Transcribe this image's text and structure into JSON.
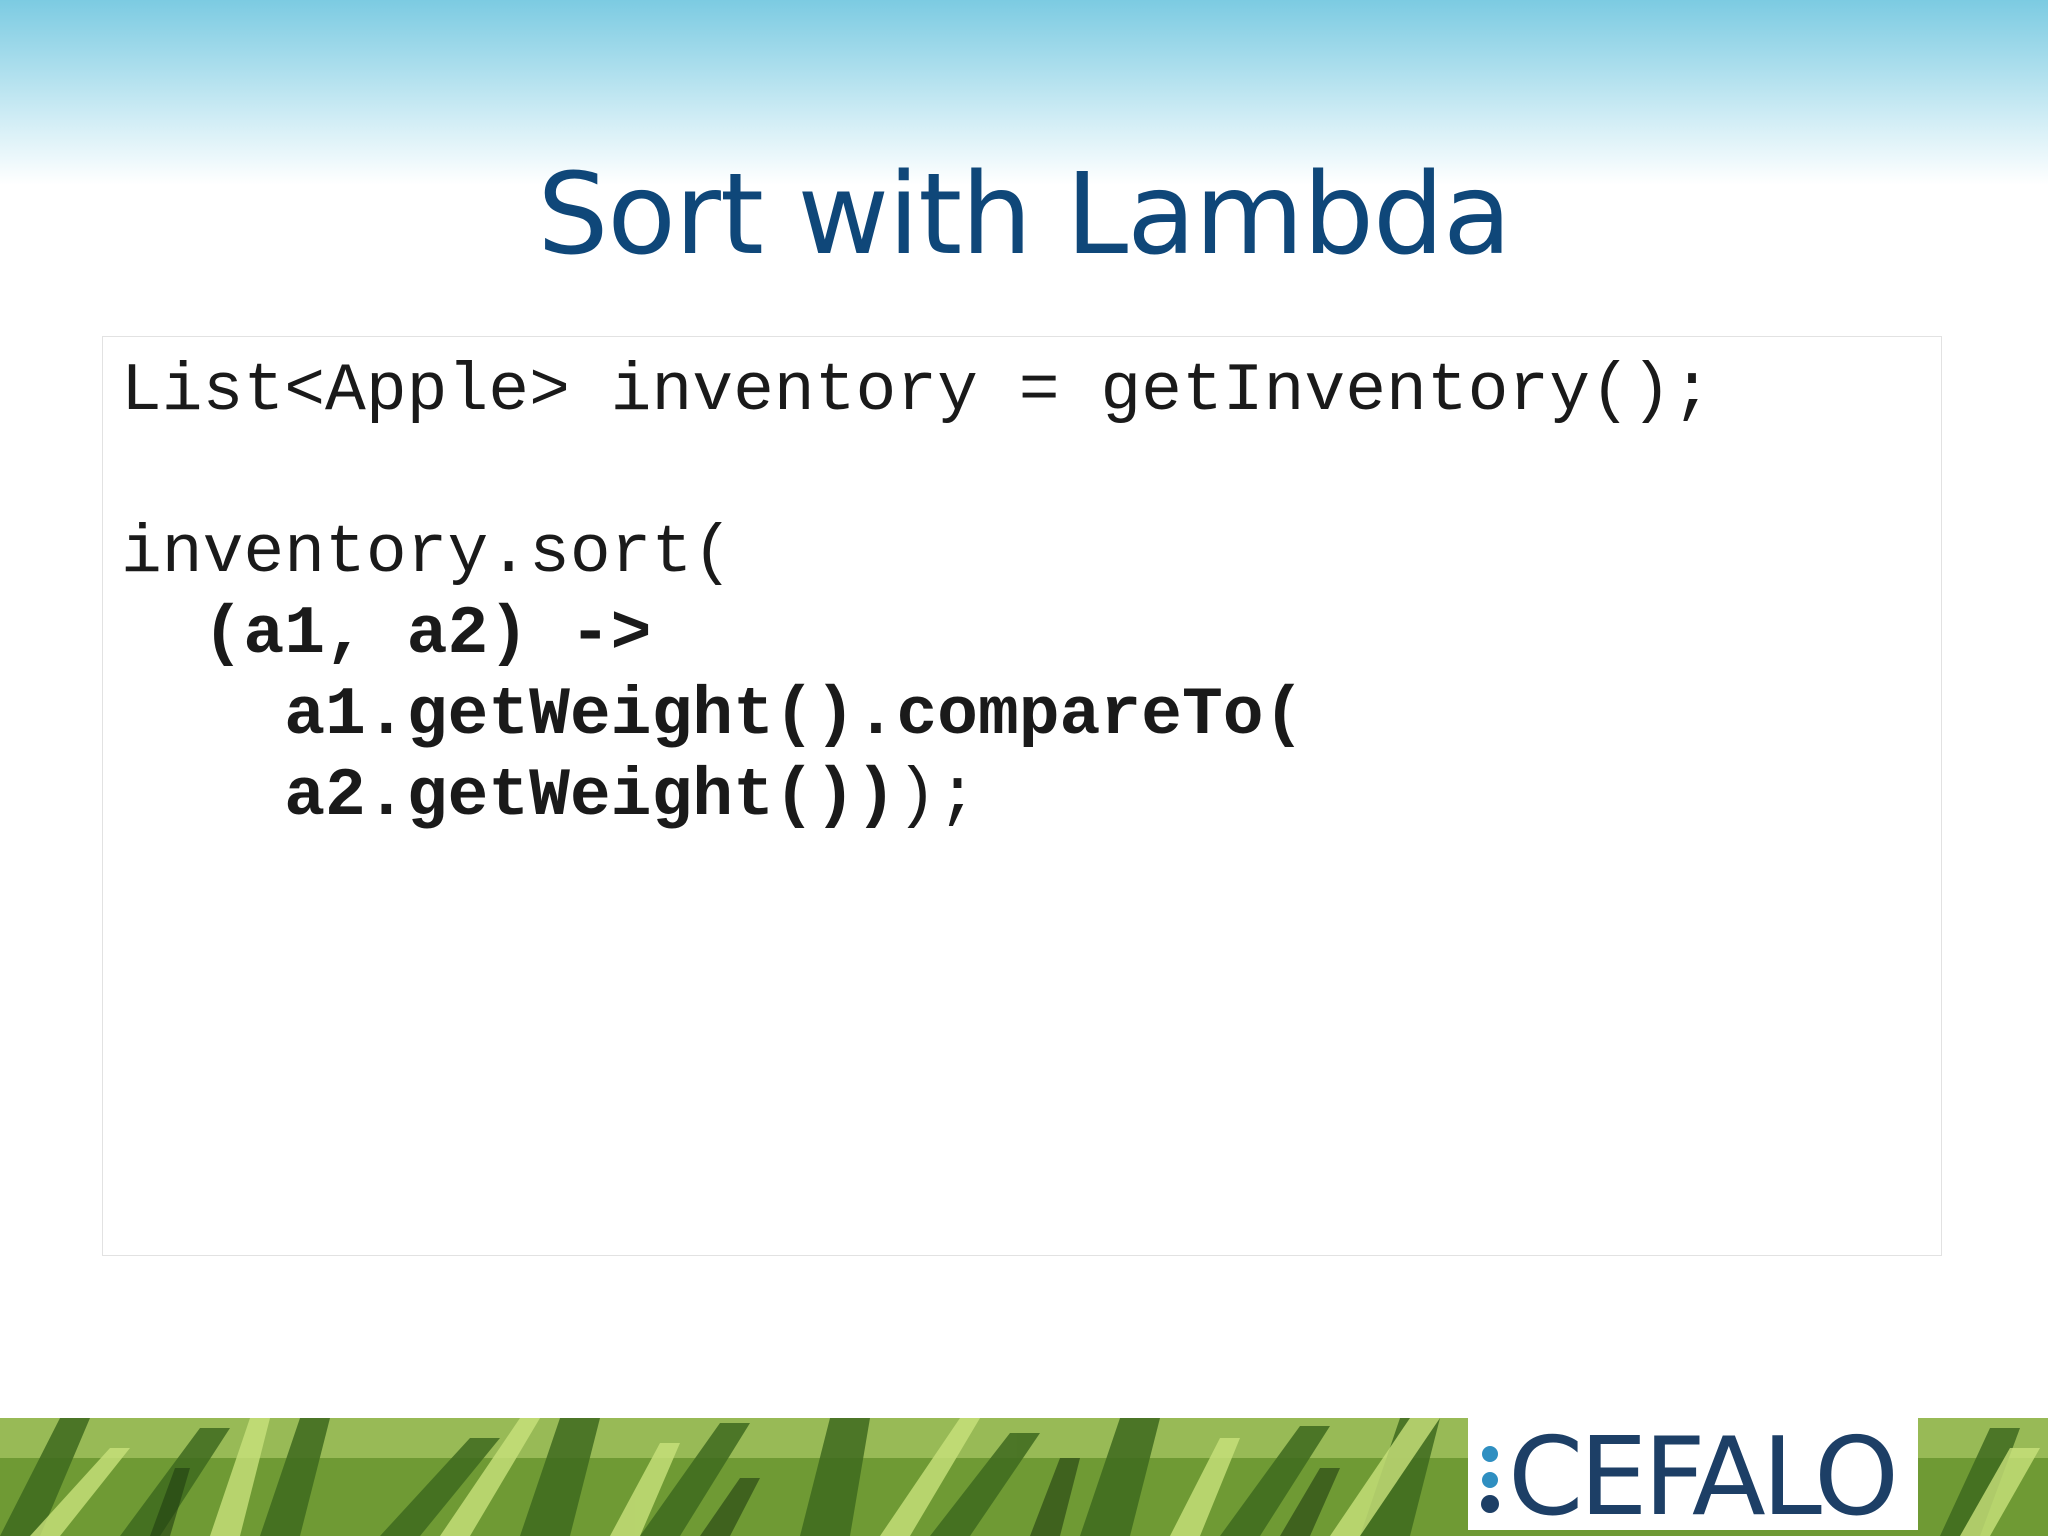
{
  "slide": {
    "title": "Sort with Lambda"
  },
  "code": {
    "line1": "List<Apple> inventory = getInventory();",
    "line2": "",
    "line3": "inventory.sort(",
    "line4_bold": "  (a1, a2) ->",
    "line5_bold": "    a1.getWeight().compareTo(",
    "line6_bold": "    a2.getWeight())",
    "line6_tail": ");"
  },
  "footer": {
    "logo_text": "CEFALO",
    "logo_dot_colors": [
      "#2f8fc1",
      "#1d3f66"
    ],
    "grass_colors": [
      "#8fbf3a",
      "#3f6b1c",
      "#c8e07a"
    ]
  }
}
